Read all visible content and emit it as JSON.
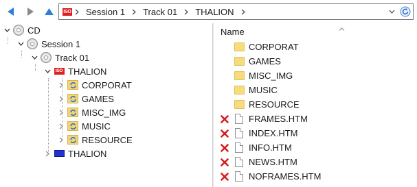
{
  "toolbar": {
    "back_icon": "back-arrow-icon",
    "forward_icon": "forward-arrow-icon",
    "up_icon": "up-arrow-icon",
    "breadcrumb": [
      "Session 1",
      "Track 01",
      "THALION"
    ],
    "iso_badge": "ISO",
    "colors": {
      "nav_blue": "#2f7fd8",
      "iso_red": "#e02020"
    }
  },
  "tree": {
    "items": [
      {
        "label": "CD",
        "icon": "cd-disc-icon"
      },
      {
        "label": "Session 1",
        "icon": "session-disc-icon"
      },
      {
        "label": "Track 01",
        "icon": "track-disc-icon"
      },
      {
        "label": "THALION",
        "icon": "iso-volume-icon",
        "badge": "ISO"
      },
      {
        "label": "CORPORAT",
        "icon": "sync-folder-icon"
      },
      {
        "label": "GAMES",
        "icon": "sync-folder-icon"
      },
      {
        "label": "MISC_IMG",
        "icon": "sync-folder-icon"
      },
      {
        "label": "MUSIC",
        "icon": "sync-folder-icon"
      },
      {
        "label": "RESOURCE",
        "icon": "sync-folder-icon"
      },
      {
        "label": "THALION",
        "icon": "blue-volume-icon"
      }
    ]
  },
  "list": {
    "column_name": "Name",
    "items": [
      {
        "label": "CORPORAT",
        "type": "folder",
        "error": false
      },
      {
        "label": "GAMES",
        "type": "folder",
        "error": false
      },
      {
        "label": "MISC_IMG",
        "type": "folder",
        "error": false
      },
      {
        "label": "MUSIC",
        "type": "folder",
        "error": false
      },
      {
        "label": "RESOURCE",
        "type": "folder",
        "error": false
      },
      {
        "label": "FRAMES.HTM",
        "type": "file",
        "error": true
      },
      {
        "label": "INDEX.HTM",
        "type": "file",
        "error": true
      },
      {
        "label": "INFO.HTM",
        "type": "file",
        "error": true
      },
      {
        "label": "NEWS.HTM",
        "type": "file",
        "error": true
      },
      {
        "label": "NOFRAMES.HTM",
        "type": "file",
        "error": true
      }
    ]
  }
}
